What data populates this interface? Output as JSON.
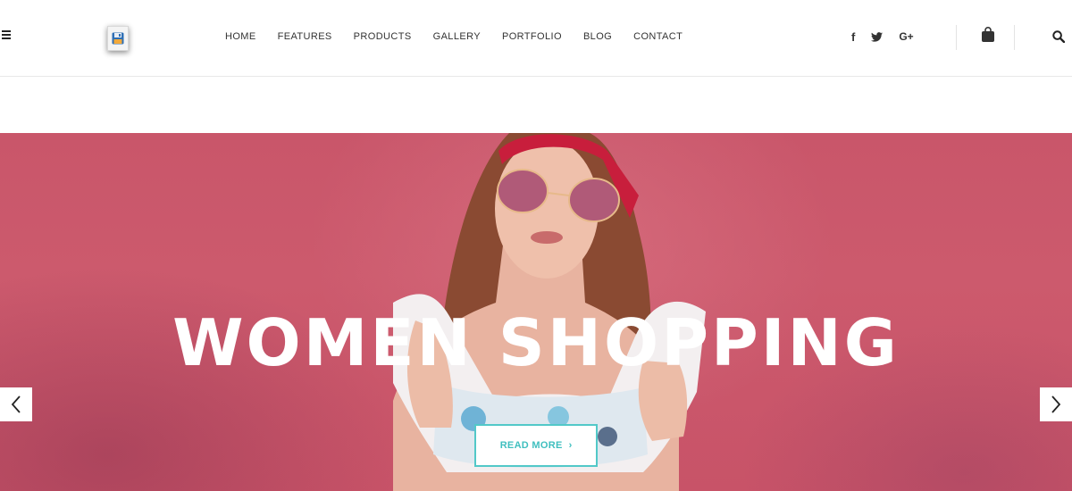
{
  "header": {
    "menu_icon": "hamburger-menu-icon",
    "logo_icon": "floppy-disk-icon",
    "nav": [
      {
        "label": "HOME"
      },
      {
        "label": "FEATURES"
      },
      {
        "label": "PRODUCTS"
      },
      {
        "label": "GALLERY"
      },
      {
        "label": "PORTFOLIO"
      },
      {
        "label": "BLOG"
      },
      {
        "label": "CONTACT"
      }
    ],
    "social": [
      {
        "icon": "facebook-icon",
        "glyph": "f"
      },
      {
        "icon": "twitter-icon"
      },
      {
        "icon": "google-plus-icon",
        "glyph": "G+"
      }
    ],
    "cart_icon": "shopping-bag-icon",
    "search_icon": "search-icon"
  },
  "hero": {
    "title": "WOMEN SHOPPING",
    "button_label": "READ MORE",
    "button_arrow": "›",
    "prev_icon": "chevron-left-icon",
    "next_icon": "chevron-right-icon",
    "background_color": "#c9566a",
    "accent_color": "#3fbfbf"
  }
}
